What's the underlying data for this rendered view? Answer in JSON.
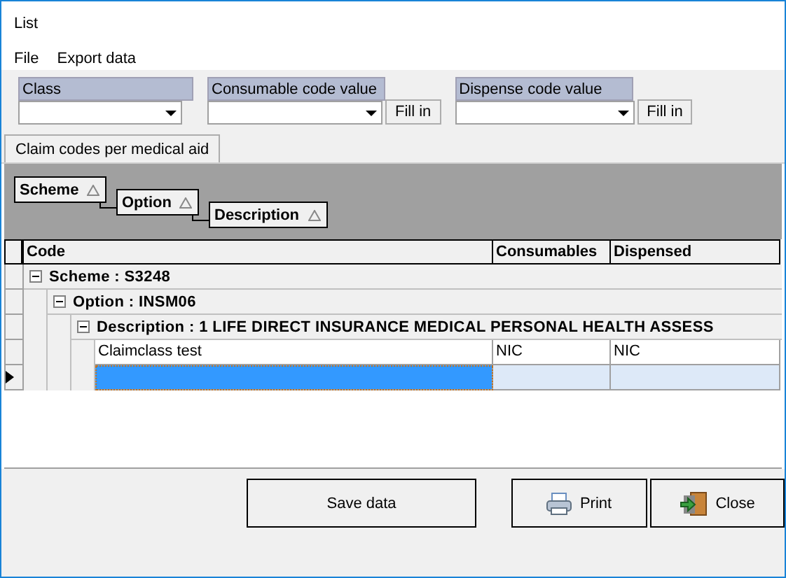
{
  "window": {
    "title": "List"
  },
  "menu": [
    {
      "label": "File"
    },
    {
      "label": "Export data"
    }
  ],
  "filters": [
    {
      "label": "Class",
      "fill_button": false
    },
    {
      "label": "Consumable code value",
      "fill_button": "Fill in"
    },
    {
      "label": "Dispense code value",
      "fill_button": "Fill in"
    }
  ],
  "tabs": [
    {
      "label": "Claim codes per medical aid",
      "selected": true
    }
  ],
  "group_by": [
    {
      "label": "Scheme"
    },
    {
      "label": "Option"
    },
    {
      "label": "Description"
    }
  ],
  "grid": {
    "columns": [
      "Code",
      "Consumables",
      "Dispensed"
    ],
    "groups": [
      {
        "label": "Scheme : S3248",
        "expanded": true,
        "children": [
          {
            "label": "Option : INSM06",
            "expanded": true,
            "children": [
              {
                "label": "Description : 1 LIFE DIRECT INSURANCE MEDICAL PERSONAL HEALTH ASSESS",
                "expanded": true,
                "rows": [
                  {
                    "cells": [
                      "Claimclass test",
                      "NIC",
                      "NIC"
                    ],
                    "selected": false
                  },
                  {
                    "cells": [],
                    "selected": true
                  }
                ]
              }
            ]
          }
        ]
      }
    ]
  },
  "buttons": [
    {
      "label": "Save data",
      "kind": "save"
    },
    {
      "label": "Print",
      "kind": "print"
    },
    {
      "label": "Close",
      "kind": "close"
    }
  ]
}
